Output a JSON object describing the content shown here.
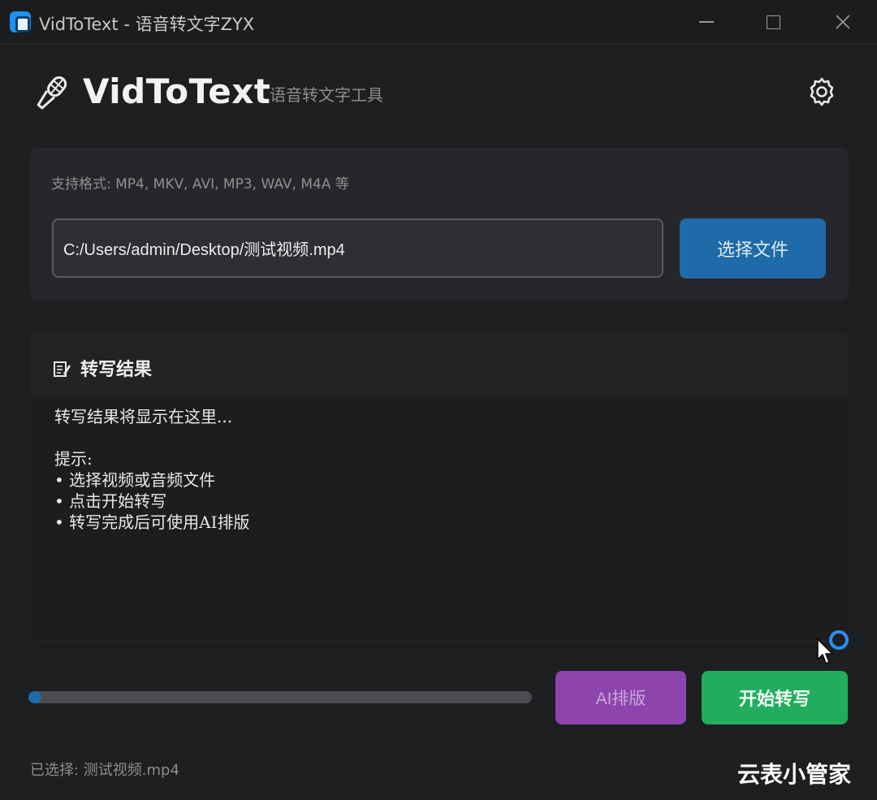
{
  "window": {
    "title": "VidToText - 语音转文字ZYX"
  },
  "header": {
    "brand": "VidToText",
    "subtitle": "语音转文字工具",
    "icons": [
      "microphone-icon",
      "gear-icon"
    ]
  },
  "file_section": {
    "formats_hint": "支持格式: MP4, MKV, AVI, MP3, WAV, M4A 等",
    "path_value": "C:/Users/admin/Desktop/测试视频.mp4",
    "choose_button": "选择文件"
  },
  "result_section": {
    "title": "转写结果",
    "icon": "memo-icon",
    "content": "转写结果将显示在这里...\n\n提示:\n• 选择视频或音频文件\n• 点击开始转写\n• 转写完成后可使用AI排版"
  },
  "controls": {
    "progress": 0.02,
    "ai_button": "AI排版",
    "start_button": "开始转写"
  },
  "status": {
    "text": "已选择: 测试视频.mp4"
  },
  "watermark": "云表小管家",
  "colors": {
    "background": "#1e1f21",
    "card": "#26272a",
    "primary_blue": "#1f6aa8",
    "ai_purple": "#8e44ad",
    "start_green": "#22ad5e"
  }
}
